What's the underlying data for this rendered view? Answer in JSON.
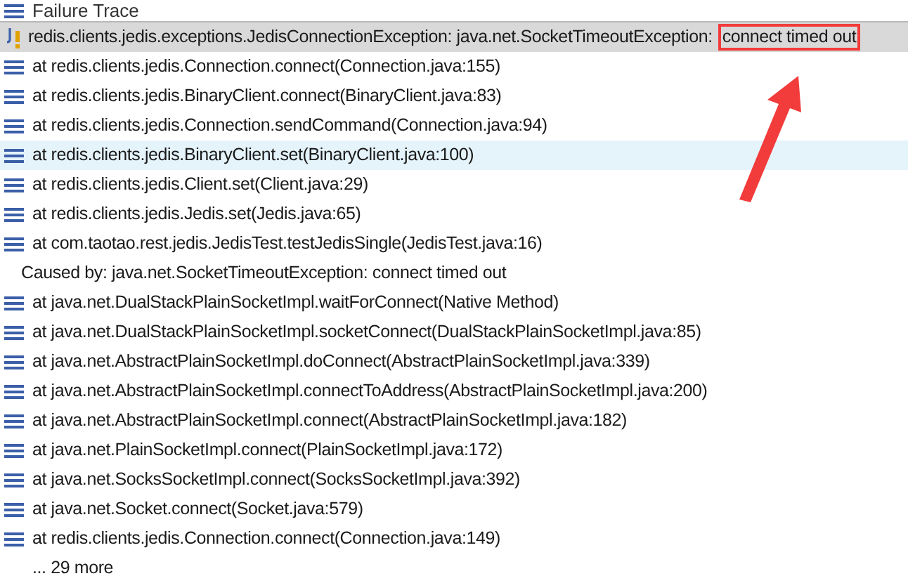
{
  "panel": {
    "title": "Failure Trace"
  },
  "rows": [
    {
      "kind": "exception",
      "text": "redis.clients.jedis.exceptions.JedisConnectionException: java.net.SocketTimeoutException:",
      "callout": "connect timed out",
      "selected": true,
      "hovered": false
    },
    {
      "kind": "frame",
      "text": "at redis.clients.jedis.Connection.connect(Connection.java:155)",
      "selected": false,
      "hovered": false
    },
    {
      "kind": "frame",
      "text": "at redis.clients.jedis.BinaryClient.connect(BinaryClient.java:83)",
      "selected": false,
      "hovered": false
    },
    {
      "kind": "frame",
      "text": "at redis.clients.jedis.Connection.sendCommand(Connection.java:94)",
      "selected": false,
      "hovered": false
    },
    {
      "kind": "frame",
      "text": "at redis.clients.jedis.BinaryClient.set(BinaryClient.java:100)",
      "selected": false,
      "hovered": true
    },
    {
      "kind": "frame",
      "text": "at redis.clients.jedis.Client.set(Client.java:29)",
      "selected": false,
      "hovered": false
    },
    {
      "kind": "frame",
      "text": "at redis.clients.jedis.Jedis.set(Jedis.java:65)",
      "selected": false,
      "hovered": false
    },
    {
      "kind": "frame",
      "text": "at com.taotao.rest.jedis.JedisTest.testJedisSingle(JedisTest.java:16)",
      "selected": false,
      "hovered": false
    },
    {
      "kind": "caused",
      "text": "Caused by: java.net.SocketTimeoutException: connect timed out",
      "selected": false,
      "hovered": false
    },
    {
      "kind": "frame",
      "text": "at java.net.DualStackPlainSocketImpl.waitForConnect(Native Method)",
      "selected": false,
      "hovered": false
    },
    {
      "kind": "frame",
      "text": "at java.net.DualStackPlainSocketImpl.socketConnect(DualStackPlainSocketImpl.java:85)",
      "selected": false,
      "hovered": false
    },
    {
      "kind": "frame",
      "text": "at java.net.AbstractPlainSocketImpl.doConnect(AbstractPlainSocketImpl.java:339)",
      "selected": false,
      "hovered": false
    },
    {
      "kind": "frame",
      "text": "at java.net.AbstractPlainSocketImpl.connectToAddress(AbstractPlainSocketImpl.java:200)",
      "selected": false,
      "hovered": false
    },
    {
      "kind": "frame",
      "text": "at java.net.AbstractPlainSocketImpl.connect(AbstractPlainSocketImpl.java:182)",
      "selected": false,
      "hovered": false
    },
    {
      "kind": "frame",
      "text": "at java.net.PlainSocketImpl.connect(PlainSocketImpl.java:172)",
      "selected": false,
      "hovered": false
    },
    {
      "kind": "frame",
      "text": "at java.net.SocksSocketImpl.connect(SocksSocketImpl.java:392)",
      "selected": false,
      "hovered": false
    },
    {
      "kind": "frame",
      "text": "at java.net.Socket.connect(Socket.java:579)",
      "selected": false,
      "hovered": false
    },
    {
      "kind": "frame",
      "text": "at redis.clients.jedis.Connection.connect(Connection.java:149)",
      "selected": false,
      "hovered": false
    },
    {
      "kind": "more",
      "text": "... 29 more",
      "selected": false,
      "hovered": false
    }
  ]
}
